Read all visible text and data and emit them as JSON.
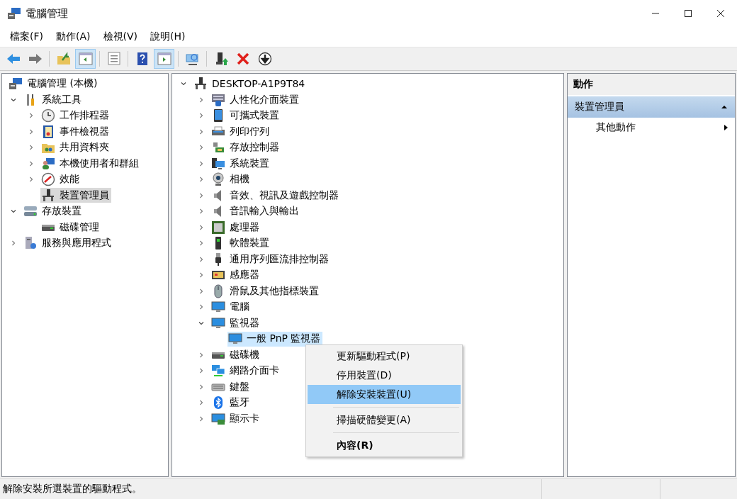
{
  "window": {
    "title": "電腦管理"
  },
  "menu_bar": [
    "檔案(F)",
    "動作(A)",
    "檢視(V)",
    "說明(H)"
  ],
  "toolbar": {
    "groups": [
      {
        "buttons": [
          {
            "kind": "back",
            "pressed": false
          },
          {
            "kind": "forward",
            "pressed": false
          }
        ]
      },
      {
        "buttons": [
          {
            "kind": "up",
            "pressed": false
          },
          {
            "kind": "console-tree",
            "pressed": true
          }
        ]
      },
      {
        "buttons": [
          {
            "kind": "export",
            "pressed": false
          }
        ]
      },
      {
        "buttons": [
          {
            "kind": "help",
            "pressed": false
          },
          {
            "kind": "action-pane",
            "pressed": true
          }
        ]
      },
      {
        "buttons": [
          {
            "kind": "monitor-search",
            "pressed": false
          }
        ]
      },
      {
        "buttons": [
          {
            "kind": "enable",
            "pressed": false
          },
          {
            "kind": "delete",
            "pressed": false
          },
          {
            "kind": "download",
            "pressed": false
          }
        ]
      }
    ]
  },
  "console_tree": [
    {
      "label": "電腦管理 (本機)",
      "kind": "computer",
      "selected": false,
      "children": [
        {
          "label": "系統工具",
          "kind": "tools",
          "selected": false,
          "expanded": true,
          "children": [
            {
              "label": "工作排程器",
              "kind": "clock",
              "selected": false,
              "expanded": false
            },
            {
              "label": "事件檢視器",
              "kind": "log-book",
              "selected": false,
              "expanded": false
            },
            {
              "label": "共用資料夾",
              "kind": "folder",
              "selected": false,
              "expanded": false
            },
            {
              "label": "本機使用者和群組",
              "kind": "users",
              "selected": false,
              "expanded": false
            },
            {
              "label": "效能",
              "kind": "gauge",
              "selected": false,
              "expanded": false
            },
            {
              "label": "裝置管理員",
              "kind": "device",
              "selected": true
            }
          ]
        },
        {
          "label": "存放裝置",
          "kind": "storage",
          "selected": false,
          "expanded": true,
          "children": [
            {
              "label": "磁碟管理",
              "kind": "disk-drive",
              "selected": false
            }
          ]
        },
        {
          "label": "服務與應用程式",
          "kind": "server",
          "selected": false,
          "expanded": false
        }
      ]
    }
  ],
  "device_tree": [
    {
      "label": "DESKTOP-A1P9T84",
      "kind": "device",
      "selected": false,
      "expanded": true,
      "children": [
        {
          "label": "人性化介面裝置",
          "kind": "input-device",
          "selected": false,
          "expanded": false
        },
        {
          "label": "可攜式裝置",
          "kind": "tablet",
          "selected": false,
          "expanded": false
        },
        {
          "label": "列印佇列",
          "kind": "printer",
          "selected": false,
          "expanded": false
        },
        {
          "label": "存放控制器",
          "kind": "controller",
          "selected": false,
          "expanded": false
        },
        {
          "label": "系統裝置",
          "kind": "system",
          "selected": false,
          "expanded": false
        },
        {
          "label": "相機",
          "kind": "webcam",
          "selected": false,
          "expanded": false
        },
        {
          "label": "音效、視訊及遊戲控制器",
          "kind": "speaker",
          "selected": false,
          "expanded": false
        },
        {
          "label": "音訊輸入與輸出",
          "kind": "speaker",
          "selected": false,
          "expanded": false
        },
        {
          "label": "處理器",
          "kind": "chip",
          "selected": false,
          "expanded": false
        },
        {
          "label": "軟體裝置",
          "kind": "software-device",
          "selected": false,
          "expanded": false
        },
        {
          "label": "通用序列匯流排控制器",
          "kind": "usb-plug",
          "selected": false,
          "expanded": false
        },
        {
          "label": "感應器",
          "kind": "sensor",
          "selected": false,
          "expanded": false
        },
        {
          "label": "滑鼠及其他指標裝置",
          "kind": "mouse",
          "selected": false,
          "expanded": false
        },
        {
          "label": "電腦",
          "kind": "monitor",
          "selected": false,
          "expanded": false
        },
        {
          "label": "監視器",
          "kind": "monitor",
          "selected": false,
          "expanded": true,
          "children": [
            {
              "label": "一般 PnP 監視器",
              "kind": "monitor",
              "selected": true
            }
          ]
        },
        {
          "label": "磁碟機",
          "kind": "drive",
          "selected": false,
          "expanded": false
        },
        {
          "label": "網路介面卡",
          "kind": "network",
          "selected": false,
          "expanded": false
        },
        {
          "label": "鍵盤",
          "kind": "keyboard",
          "selected": false,
          "expanded": false
        },
        {
          "label": "藍牙",
          "kind": "bluetooth",
          "selected": false,
          "expanded": false
        },
        {
          "label": "顯示卡",
          "kind": "display-adapter",
          "selected": false,
          "expanded": false
        }
      ]
    }
  ],
  "context_menu": [
    {
      "kind": "item",
      "label": "更新驅動程式(P)",
      "selected": false,
      "default": false
    },
    {
      "kind": "item",
      "label": "停用裝置(D)",
      "selected": false,
      "default": false
    },
    {
      "kind": "item",
      "label": "解除安裝裝置(U)",
      "selected": true,
      "default": false
    },
    {
      "kind": "separator"
    },
    {
      "kind": "item",
      "label": "掃描硬體變更(A)",
      "selected": false,
      "default": false
    },
    {
      "kind": "separator"
    },
    {
      "kind": "item",
      "label": "內容(R)",
      "selected": false,
      "default": true
    }
  ],
  "actions_pane": {
    "title": "動作",
    "sections": [
      {
        "title": "裝置管理員",
        "expanded": true,
        "items": [
          {
            "label": "其他動作",
            "submenu": true
          }
        ]
      }
    ]
  },
  "status_bar": {
    "text": "解除安裝所選裝置的驅動程式。"
  }
}
